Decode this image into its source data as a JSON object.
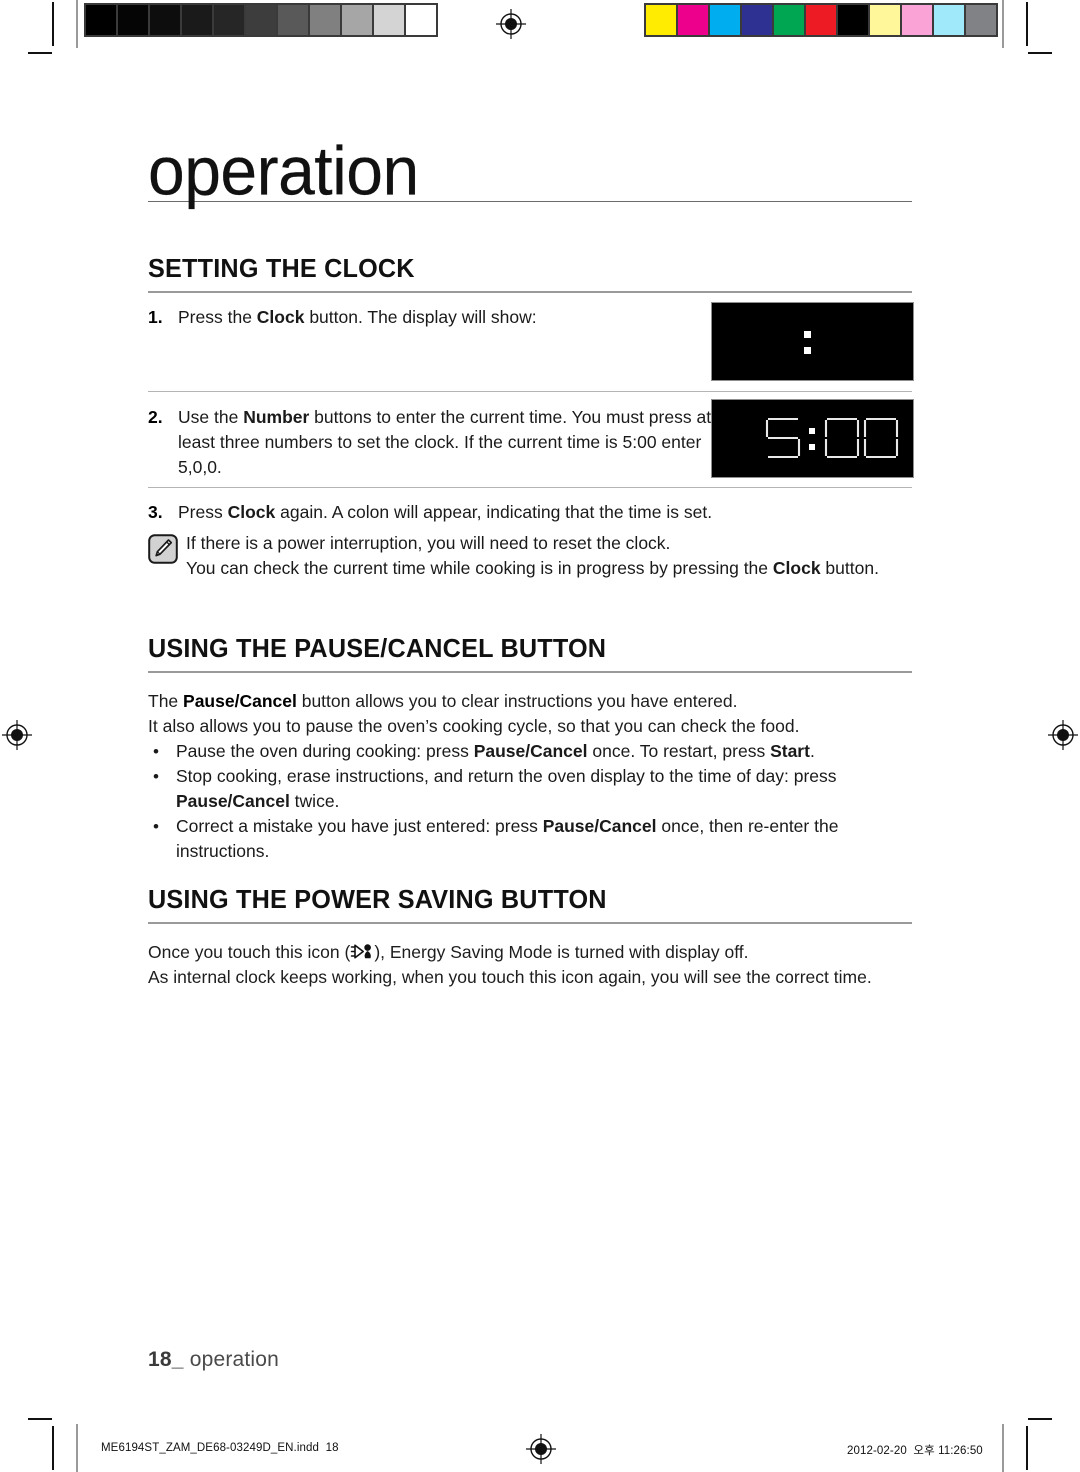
{
  "document": {
    "chapter_title": "operation",
    "folio_page": "18_",
    "folio_label": "operation"
  },
  "prepress": {
    "grayscale_patches": [
      "#000000",
      "#050505",
      "#0d0d0d",
      "#1a1a1a",
      "#262626",
      "#3d3d3d",
      "#595959",
      "#808080",
      "#a6a6a6",
      "#d4d4d4",
      "#ffffff"
    ],
    "color_patches": [
      "#ffec00",
      "#ec008c",
      "#00aeef",
      "#2e3192",
      "#00a651",
      "#ed1c24",
      "#000000",
      "#fff79a",
      "#f9a3d7",
      "#a0e9fb",
      "#808285"
    ]
  },
  "sections": [
    {
      "id": "setting-the-clock",
      "heading": "SETTING THE CLOCK",
      "steps": [
        {
          "num": "1.",
          "parts": [
            {
              "t": "Press the ",
              "b": false
            },
            {
              "t": "Clock",
              "b": true
            },
            {
              "t": " button. The display will show:",
              "b": false
            }
          ]
        },
        {
          "num": "2.",
          "parts": [
            {
              "t": "Use the ",
              "b": false
            },
            {
              "t": "Number",
              "b": true
            },
            {
              "t": " buttons to enter the current time. You must press at least three numbers to set the clock. If the current time is 5:00 enter 5,0,0.",
              "b": false
            }
          ]
        },
        {
          "num": "3.",
          "parts": [
            {
              "t": "Press ",
              "b": false
            },
            {
              "t": "Clock",
              "b": true
            },
            {
              "t": " again. A colon will appear, indicating that the time is set.",
              "b": false
            }
          ]
        }
      ],
      "note": [
        {
          "t": "If there is a power interruption, you will need to reset the clock.",
          "b": false
        },
        {
          "t": "\n",
          "b": false
        },
        {
          "t": "You can check the current time while cooking is in progress by pressing the ",
          "b": false
        },
        {
          "t": "Clock",
          "b": true
        },
        {
          "t": " button.",
          "b": false
        }
      ],
      "displays": [
        {
          "id": "display-colon-only",
          "value": ":",
          "segments": "colon"
        },
        {
          "id": "display-five-oclock",
          "value": "5:00",
          "segments": "5:00"
        }
      ]
    },
    {
      "id": "using-the-pause-cancel-button",
      "heading": "USING THE PAUSE/CANCEL BUTTON",
      "paragraphs": [
        [
          {
            "t": "The ",
            "b": false
          },
          {
            "t": "Pause/Cancel",
            "b": true
          },
          {
            "t": " button allows you to clear instructions you have entered.",
            "b": false
          }
        ],
        [
          {
            "t": "It also allows you to pause the oven’s cooking cycle, so that you can check the food.",
            "b": false
          }
        ]
      ],
      "bullets": [
        [
          {
            "t": "Pause the oven during cooking: press ",
            "b": false
          },
          {
            "t": "Pause/Cancel",
            "b": true
          },
          {
            "t": " once. To restart, press ",
            "b": false
          },
          {
            "t": "Start",
            "b": true
          },
          {
            "t": ".",
            "b": false
          }
        ],
        [
          {
            "t": "Stop cooking, erase instructions, and return the oven display to the time of day: press ",
            "b": false
          },
          {
            "t": "Pause/Cancel",
            "b": true
          },
          {
            "t": " twice.",
            "b": false
          }
        ],
        [
          {
            "t": "Correct a mistake you have just entered: press ",
            "b": false
          },
          {
            "t": "Pause/Cancel",
            "b": true
          },
          {
            "t": " once, then re-enter the instructions.",
            "b": false
          }
        ]
      ]
    },
    {
      "id": "using-the-power-saving-button",
      "heading": "USING THE POWER SAVING BUTTON",
      "paragraph_before_icon": "Once you touch this icon (",
      "paragraph_after_icon": "), Energy Saving Mode is turned with display off.",
      "paragraph_2": "As internal clock keeps working, when you touch this icon again, you will see the correct time."
    }
  ],
  "print_footer": {
    "file_name": "ME6194ST_ZAM_DE68-03249D_EN.indd",
    "page_number": "18",
    "date": "2012-02-20",
    "locale_mark": "오후",
    "time": "11:26:50"
  }
}
